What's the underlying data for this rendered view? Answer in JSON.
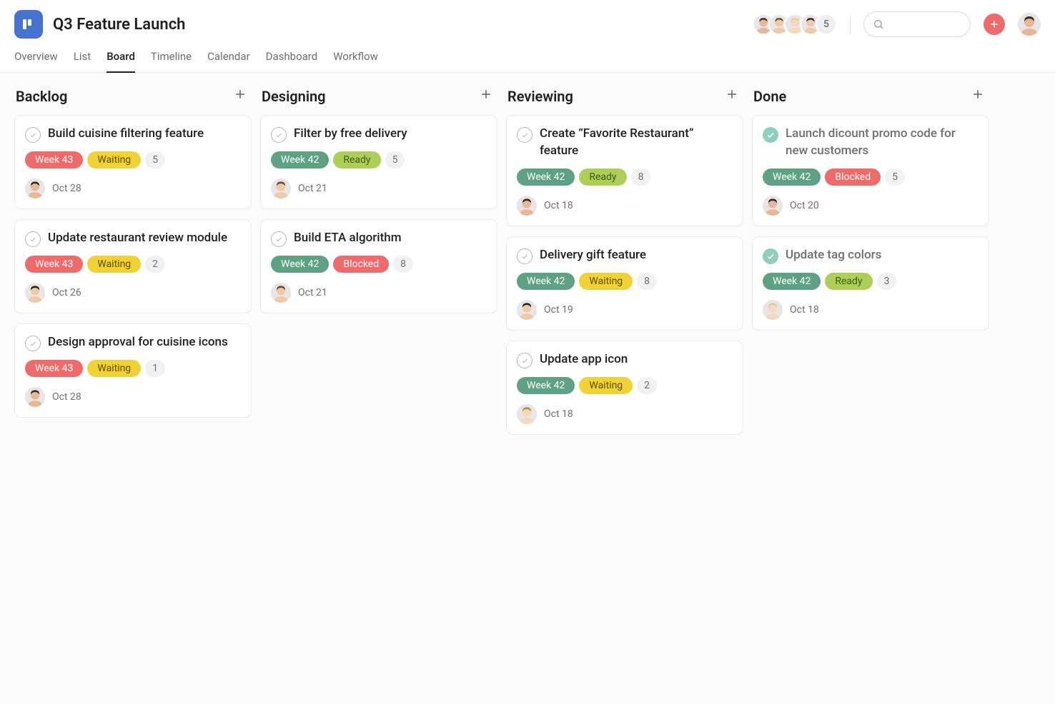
{
  "project": {
    "title": "Q3 Feature Launch"
  },
  "tabs": [
    {
      "label": "Overview",
      "active": false
    },
    {
      "label": "List",
      "active": false
    },
    {
      "label": "Board",
      "active": true
    },
    {
      "label": "Timeline",
      "active": false
    },
    {
      "label": "Calendar",
      "active": false
    },
    {
      "label": "Dashboard",
      "active": false
    },
    {
      "label": "Workflow",
      "active": false
    }
  ],
  "members_overflow": "5",
  "tag_colors": {
    "Week 43": {
      "bg": "#f06a6a",
      "fg": "#ffffff"
    },
    "Week 42": {
      "bg": "#5da283",
      "fg": "#ffffff"
    },
    "Waiting": {
      "bg": "#f1d233",
      "fg": "#5a4b00"
    },
    "Ready": {
      "bg": "#aecf55",
      "fg": "#3e5a1a"
    },
    "Blocked": {
      "bg": "#f06a6a",
      "fg": "#ffffff"
    }
  },
  "avatar_colors": {
    "p1": {
      "skin": "#e8b894",
      "hair": "#3b2a1a"
    },
    "p2": {
      "skin": "#f1c9a5",
      "hair": "#6b4a2e"
    },
    "p3": {
      "skin": "#f6d7b8",
      "hair": "#e7cf8b"
    },
    "p4": {
      "skin": "#f1c9a5",
      "hair": "#2c201a"
    },
    "p5": {
      "skin": "#f6d7b8",
      "hair": "#b58a4a"
    }
  },
  "columns": [
    {
      "title": "Backlog",
      "cards": [
        {
          "title": "Build cuisine filtering feature",
          "done": false,
          "tags": [
            "Week 43",
            "Waiting"
          ],
          "count": "5",
          "assignee": "p1",
          "due": "Oct 28"
        },
        {
          "title": "Update restaurant review module",
          "done": false,
          "tags": [
            "Week 43",
            "Waiting"
          ],
          "count": "2",
          "assignee": "p4",
          "due": "Oct 26"
        },
        {
          "title": "Design approval for cuisine icons",
          "done": false,
          "tags": [
            "Week 43",
            "Waiting"
          ],
          "count": "1",
          "assignee": "p1",
          "due": "Oct 28"
        }
      ]
    },
    {
      "title": "Designing",
      "cards": [
        {
          "title": "Filter by free delivery",
          "done": false,
          "tags": [
            "Week 42",
            "Ready"
          ],
          "count": "5",
          "assignee": "p2",
          "due": "Oct 21"
        },
        {
          "title": "Build ETA algorithm",
          "done": false,
          "tags": [
            "Week 42",
            "Blocked"
          ],
          "count": "8",
          "assignee": "p2",
          "due": "Oct 21"
        }
      ]
    },
    {
      "title": "Reviewing",
      "cards": [
        {
          "title": "Create “Favorite Restaurant” feature",
          "done": false,
          "tags": [
            "Week 42",
            "Ready"
          ],
          "count": "8",
          "assignee": "p1",
          "due": "Oct 18"
        },
        {
          "title": "Delivery gift feature",
          "done": false,
          "tags": [
            "Week 42",
            "Waiting"
          ],
          "count": "8",
          "assignee": "p4",
          "due": "Oct 19"
        },
        {
          "title": "Update app icon",
          "done": false,
          "tags": [
            "Week 42",
            "Waiting"
          ],
          "count": "2",
          "assignee": "p5",
          "due": "Oct 18"
        }
      ]
    },
    {
      "title": "Done",
      "cards": [
        {
          "title": "Launch dicount promo code for new customers",
          "done": true,
          "tags": [
            "Week 42",
            "Blocked"
          ],
          "count": "5",
          "assignee": "p1",
          "due": "Oct 20"
        },
        {
          "title": "Update tag colors",
          "done": true,
          "tags": [
            "Week 42",
            "Ready"
          ],
          "count": "3",
          "assignee": "p3",
          "due": "Oct 18"
        }
      ]
    }
  ]
}
